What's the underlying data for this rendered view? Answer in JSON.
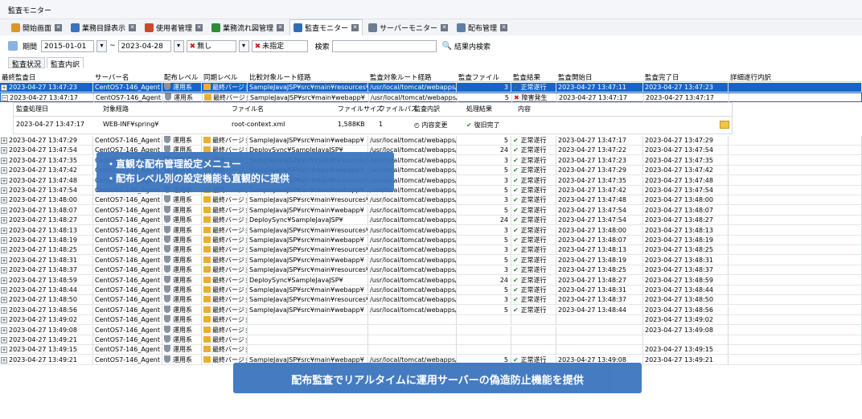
{
  "app_title": "監査モニター",
  "tabs": [
    {
      "label": "開始画面",
      "icon": "home-icon",
      "color": "#d9962b"
    },
    {
      "label": "業務目録表示",
      "icon": "list-icon",
      "color": "#3b6fc2"
    },
    {
      "label": "使用者管理",
      "icon": "users-icon",
      "color": "#c94a2a"
    },
    {
      "label": "業務流れ図管理",
      "icon": "flow-icon",
      "color": "#2e8b3a"
    },
    {
      "label": "監査モニター",
      "icon": "magnifier-icon",
      "color": "#2f6fb4",
      "active": true
    },
    {
      "label": "サーバーモニター",
      "icon": "server-monitor-icon",
      "color": "#6c7c92"
    },
    {
      "label": "配布管理",
      "icon": "deploy-icon",
      "color": "#5c7fa8"
    }
  ],
  "filter": {
    "period_label": "期間",
    "date_from": "2015-01-01",
    "range_sep": "~",
    "date_to": "2023-04-28",
    "level_value": "無し",
    "status_value": "未指定",
    "search_label": "検索",
    "search_value": "",
    "result_search_label": "結果内検索"
  },
  "subtabs": [
    "監査状況",
    "監査内訳"
  ],
  "columns": [
    "最終監査日",
    "サーバー名",
    "配布レベル",
    "同期レベル",
    "比較対象ルート経路",
    "監査対象ルート経路",
    "監査ファイル",
    "監査結果",
    "監査開始日",
    "監査完了日",
    "詳細遂行内訳"
  ],
  "sub_columns": [
    "監査処理日",
    "対象経路",
    "ファイル名",
    "ファイルサイズ",
    "ファイルパス",
    "監査内訳",
    "処理結果",
    "内容"
  ],
  "sub_row": [
    "2023-04-27 13:47:17",
    "WEB-INF¥spring¥",
    "root-context.xml",
    "1,588KB",
    "1",
    "内容変更",
    "復旧完了",
    ""
  ],
  "rows": [
    [
      "2023-04-27 13:47:23",
      "CentOS7-146_Agent",
      "運用系",
      "最終バージョン",
      "SampleJavaJSP¥src¥main¥resources¥",
      "/usr/local/tomcat/webapps/Samp",
      "3",
      "正常遂行",
      "2023-04-27 13:47:11",
      "2023-04-27 13:47:23"
    ],
    [
      "2023-04-27 13:47:17",
      "CentOS7-146_Agent",
      "運用系",
      "最終バージョン",
      "SampleJavaJSP¥src¥main¥webapp¥",
      "/usr/local/tomcat/webapps/Samp",
      "5",
      "障害発生",
      "2023-04-27 13:47:17",
      "2023-04-27 13:47:17"
    ],
    [
      "2023-04-27 13:47:29",
      "CentOS7-146_Agent",
      "運用系",
      "最終バージョン",
      "SampleJavaJSP¥src¥main¥webapp¥",
      "/usr/local/tomcat/webapps/Samp",
      "5",
      "正常遂行",
      "2023-04-27 13:47:17",
      "2023-04-27 13:47:29"
    ],
    [
      "2023-04-27 13:47:54",
      "CentOS7-146_Agent",
      "運用系",
      "最終バージョン",
      "DeploySync¥SampleJavaJSP¥",
      "/usr/local/tomcat/webapps/Samp",
      "24",
      "正常遂行",
      "2023-04-27 13:47:22",
      "2023-04-27 13:47:54"
    ],
    [
      "2023-04-27 13:47:35",
      "CentOS7-146_Agent",
      "運用系",
      "最終バージョン",
      "SampleJavaJSP¥src¥main¥resources¥",
      "/usr/local/tomcat/webapps/Samp",
      "3",
      "正常遂行",
      "2023-04-27 13:47:23",
      "2023-04-27 13:47:35"
    ],
    [
      "2023-04-27 13:47:42",
      "CentOS7-146_Agent",
      "運用系",
      "最終バージョン",
      "SampleJavaJSP¥src¥main¥webapp¥",
      "/usr/local/tomcat/webapps/Samp",
      "5",
      "正常遂行",
      "2023-04-27 13:47:29",
      "2023-04-27 13:47:42"
    ],
    [
      "2023-04-27 13:47:48",
      "CentOS7-146_Agent",
      "運用系",
      "最終バージョン",
      "SampleJavaJSP¥src¥main¥resources¥",
      "/usr/local/tomcat/webapps/Samp",
      "3",
      "正常遂行",
      "2023-04-27 13:47:35",
      "2023-04-27 13:47:48"
    ],
    [
      "2023-04-27 13:47:54",
      "CentOS7-146_Agent",
      "運用系",
      "最終バージョン",
      "SampleJavaJSP¥src¥main¥webapp¥",
      "/usr/local/tomcat/webapps/Samp",
      "5",
      "正常遂行",
      "2023-04-27 13:47:42",
      "2023-04-27 13:47:54"
    ],
    [
      "2023-04-27 13:48:00",
      "CentOS7-146_Agent",
      "運用系",
      "最終バージョン",
      "SampleJavaJSP¥src¥main¥resources¥",
      "/usr/local/tomcat/webapps/Samp",
      "3",
      "正常遂行",
      "2023-04-27 13:47:48",
      "2023-04-27 13:48:00"
    ],
    [
      "2023-04-27 13:48:07",
      "CentOS7-146_Agent",
      "運用系",
      "最終バージョン",
      "SampleJavaJSP¥src¥main¥webapp¥",
      "/usr/local/tomcat/webapps/Samp",
      "5",
      "正常遂行",
      "2023-04-27 13:47:54",
      "2023-04-27 13:48:07"
    ],
    [
      "2023-04-27 13:48:27",
      "CentOS7-146_Agent",
      "運用系",
      "最終バージョン",
      "DeploySync¥SampleJavaJSP¥",
      "/usr/local/tomcat/webapps/Samp",
      "24",
      "正常遂行",
      "2023-04-27 13:47:54",
      "2023-04-27 13:48:27"
    ],
    [
      "2023-04-27 13:48:13",
      "CentOS7-146_Agent",
      "運用系",
      "最終バージョン",
      "SampleJavaJSP¥src¥main¥resources¥",
      "/usr/local/tomcat/webapps/Samp",
      "3",
      "正常遂行",
      "2023-04-27 13:48:00",
      "2023-04-27 13:48:13"
    ],
    [
      "2023-04-27 13:48:19",
      "CentOS7-146_Agent",
      "運用系",
      "最終バージョン",
      "SampleJavaJSP¥src¥main¥webapp¥",
      "/usr/local/tomcat/webapps/Samp",
      "5",
      "正常遂行",
      "2023-04-27 13:48:07",
      "2023-04-27 13:48:19"
    ],
    [
      "2023-04-27 13:48:25",
      "CentOS7-146_Agent",
      "運用系",
      "最終バージョン",
      "SampleJavaJSP¥src¥main¥resources¥",
      "/usr/local/tomcat/webapps/Samp",
      "3",
      "正常遂行",
      "2023-04-27 13:48:13",
      "2023-04-27 13:48:25"
    ],
    [
      "2023-04-27 13:48:31",
      "CentOS7-146_Agent",
      "運用系",
      "最終バージョン",
      "SampleJavaJSP¥src¥main¥webapp¥",
      "/usr/local/tomcat/webapps/Samp",
      "5",
      "正常遂行",
      "2023-04-27 13:48:19",
      "2023-04-27 13:48:31"
    ],
    [
      "2023-04-27 13:48:37",
      "CentOS7-146_Agent",
      "運用系",
      "最終バージョン",
      "SampleJavaJSP¥src¥main¥resources¥",
      "/usr/local/tomcat/webapps/Samp",
      "3",
      "正常遂行",
      "2023-04-27 13:48:25",
      "2023-04-27 13:48:37"
    ],
    [
      "2023-04-27 13:48:59",
      "CentOS7-146_Agent",
      "運用系",
      "最終バージョン",
      "DeploySync¥SampleJavaJSP¥",
      "/usr/local/tomcat/webapps/Samp",
      "24",
      "正常遂行",
      "2023-04-27 13:48:27",
      "2023-04-27 13:48:59"
    ],
    [
      "2023-04-27 13:48:44",
      "CentOS7-146_Agent",
      "運用系",
      "最終バージョン",
      "SampleJavaJSP¥src¥main¥webapp¥",
      "/usr/local/tomcat/webapps/Samp",
      "5",
      "正常遂行",
      "2023-04-27 13:48:31",
      "2023-04-27 13:48:44"
    ],
    [
      "2023-04-27 13:48:50",
      "CentOS7-146_Agent",
      "運用系",
      "最終バージョン",
      "SampleJavaJSP¥src¥main¥resources¥",
      "/usr/local/tomcat/webapps/Samp",
      "3",
      "正常遂行",
      "2023-04-27 13:48:37",
      "2023-04-27 13:48:50"
    ],
    [
      "2023-04-27 13:48:56",
      "CentOS7-146_Agent",
      "運用系",
      "最終バージョン",
      "SampleJavaJSP¥src¥main¥webapp¥",
      "/usr/local/tomcat/webapps/Samp",
      "5",
      "正常遂行",
      "2023-04-27 13:48:44",
      "2023-04-27 13:48:56"
    ],
    [
      "2023-04-27 13:49:02",
      "CentOS7-146_Agent",
      "運用系",
      "最終バージョン",
      "",
      "",
      "",
      "",
      "",
      "2023-04-27 13:49:02"
    ],
    [
      "2023-04-27 13:49:08",
      "CentOS7-146_Agent",
      "運用系",
      "最終バージョン",
      "",
      "",
      "",
      "",
      "",
      "2023-04-27 13:49:08"
    ],
    [
      "2023-04-27 13:49:21",
      "CentOS7-146_Agent",
      "運用系",
      "最終バージョン",
      "",
      "",
      "",
      "",
      "",
      ""
    ],
    [
      "2023-04-27 13:49:15",
      "CentOS7-146_Agent",
      "運用系",
      "最終バージョン",
      "",
      "",
      "",
      "",
      "",
      "2023-04-27 13:49:15"
    ],
    [
      "2023-04-27 13:49:21",
      "CentOS7-146_Agent",
      "運用系",
      "最終バージョン",
      "SampleJavaJSP¥src¥main¥webapp¥",
      "/usr/local/tomcat/webapps/Samp",
      "5",
      "正常遂行",
      "2023-04-27 13:49:08",
      "2023-04-27 13:49:21"
    ]
  ],
  "callout_top": [
    "・直観な配布管理設定メニュー",
    "・配布レベル別の設定機能も直観的に提供"
  ],
  "callout_bottom": "配布監査でリアルタイムに運用サーバーの偽造防止機能を提供",
  "colors": {
    "selected": "#1366c9",
    "ok": "#2f8f2f",
    "error": "#d01a1a",
    "callout": "#3a74be"
  }
}
